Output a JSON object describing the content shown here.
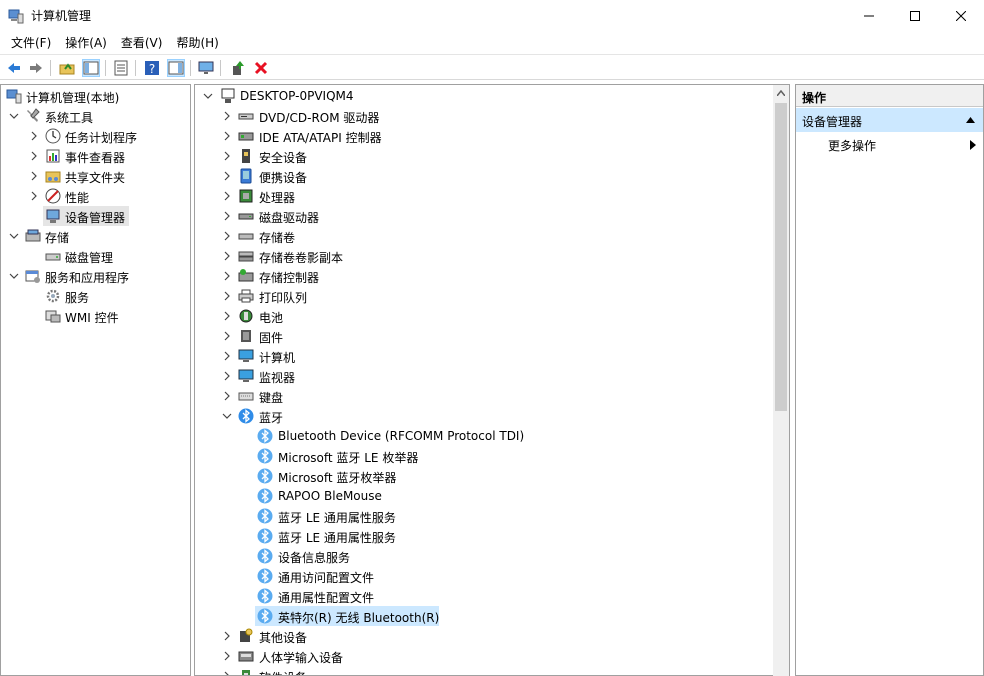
{
  "window": {
    "title": "计算机管理"
  },
  "menu": [
    "文件(F)",
    "操作(A)",
    "查看(V)",
    "帮助(H)"
  ],
  "left_tree": [
    {
      "label": "计算机管理(本地)",
      "level": 0,
      "chev": "none",
      "icon": "computer-management-icon"
    },
    {
      "label": "系统工具",
      "level": 1,
      "chev": "down",
      "icon": "tools-icon"
    },
    {
      "label": "任务计划程序",
      "level": 2,
      "chev": "right",
      "icon": "clock-icon"
    },
    {
      "label": "事件查看器",
      "level": 2,
      "chev": "right",
      "icon": "event-viewer-icon"
    },
    {
      "label": "共享文件夹",
      "level": 2,
      "chev": "right",
      "icon": "shared-folder-icon"
    },
    {
      "label": "性能",
      "level": 2,
      "chev": "right",
      "icon": "performance-icon"
    },
    {
      "label": "设备管理器",
      "level": 2,
      "chev": "none",
      "icon": "device-manager-icon",
      "selected": true
    },
    {
      "label": "存储",
      "level": 1,
      "chev": "down",
      "icon": "storage-icon"
    },
    {
      "label": "磁盘管理",
      "level": 2,
      "chev": "none",
      "icon": "disk-management-icon"
    },
    {
      "label": "服务和应用程序",
      "level": 1,
      "chev": "down",
      "icon": "services-apps-icon"
    },
    {
      "label": "服务",
      "level": 2,
      "chev": "none",
      "icon": "gear-icon"
    },
    {
      "label": "WMI 控件",
      "level": 2,
      "chev": "none",
      "icon": "wmi-icon"
    }
  ],
  "device_tree": {
    "root": "DESKTOP-0PVIQM4",
    "categories": [
      {
        "label": "DVD/CD-ROM 驱动器",
        "icon": "dvd-icon"
      },
      {
        "label": "IDE ATA/ATAPI 控制器",
        "icon": "ide-controller-icon"
      },
      {
        "label": "安全设备",
        "icon": "security-device-icon"
      },
      {
        "label": "便携设备",
        "icon": "portable-device-icon"
      },
      {
        "label": "处理器",
        "icon": "processor-icon"
      },
      {
        "label": "磁盘驱动器",
        "icon": "disk-drive-icon"
      },
      {
        "label": "存储卷",
        "icon": "storage-volume-icon"
      },
      {
        "label": "存储卷卷影副本",
        "icon": "shadow-copy-icon"
      },
      {
        "label": "存储控制器",
        "icon": "storage-controller-icon"
      },
      {
        "label": "打印队列",
        "icon": "printer-icon"
      },
      {
        "label": "电池",
        "icon": "battery-icon"
      },
      {
        "label": "固件",
        "icon": "firmware-icon"
      },
      {
        "label": "计算机",
        "icon": "computer-icon"
      },
      {
        "label": "监视器",
        "icon": "monitor-icon"
      },
      {
        "label": "键盘",
        "icon": "keyboard-icon"
      }
    ],
    "bluetooth": {
      "label": "蓝牙",
      "children": [
        "Bluetooth Device (RFCOMM Protocol TDI)",
        "Microsoft 蓝牙 LE 枚举器",
        "Microsoft 蓝牙枚举器",
        "RAPOO BleMouse",
        "蓝牙 LE 通用属性服务",
        "蓝牙 LE 通用属性服务",
        "设备信息服务",
        "通用访问配置文件",
        "通用属性配置文件",
        "英特尔(R) 无线 Bluetooth(R)"
      ],
      "selected_index": 9
    },
    "after": [
      {
        "label": "其他设备",
        "icon": "other-device-icon"
      },
      {
        "label": "人体学输入设备",
        "icon": "hid-icon"
      },
      {
        "label": "软件设备",
        "icon": "software-device-icon"
      }
    ]
  },
  "actions_pane": {
    "header": "操作",
    "section": "设备管理器",
    "more": "更多操作"
  },
  "colors": {
    "selection": "#cce8ff",
    "bluetooth": "#2f8ce8",
    "close_red": "#e81123"
  }
}
